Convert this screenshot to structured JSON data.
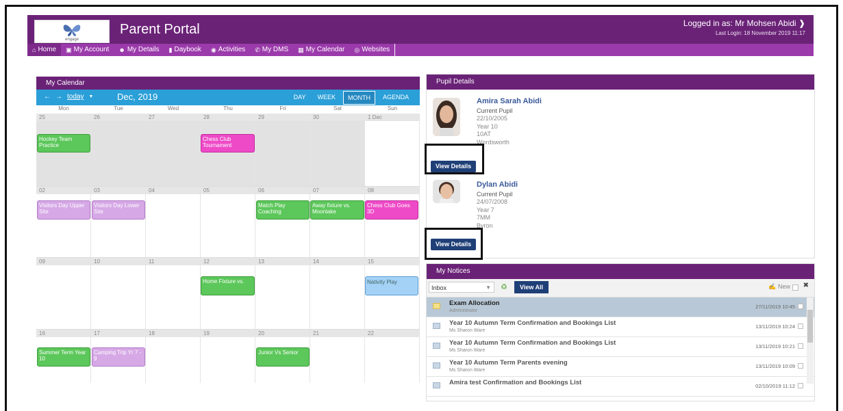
{
  "header": {
    "logo_text": "engage",
    "app_title": "Parent Portal",
    "logged_in": "Logged in as: Mr Mohsen Abidi",
    "last_login": "Last Login: 18 November 2019 11:17",
    "brand_color": "#6a2277"
  },
  "nav": {
    "items": [
      {
        "label": "Home",
        "icon": "home-icon"
      },
      {
        "label": "My Account",
        "icon": "id-card-icon"
      },
      {
        "label": "My Details",
        "icon": "user-icon"
      },
      {
        "label": "Daybook",
        "icon": "book-icon"
      },
      {
        "label": "Activities",
        "icon": "activity-icon"
      },
      {
        "label": "My DMS",
        "icon": "dms-icon"
      },
      {
        "label": "My Calendar",
        "icon": "calendar-icon"
      },
      {
        "label": "Websites",
        "icon": "globe-icon"
      }
    ]
  },
  "calendar": {
    "panel_title": "My Calendar",
    "today_label": "today",
    "month_title": "Dec, 2019",
    "views": [
      "DAY",
      "WEEK",
      "MONTH",
      "AGENDA"
    ],
    "active_view": "MONTH",
    "dow": [
      "Mon",
      "Tue",
      "Wed",
      "Thu",
      "Fri",
      "Sat",
      "Sun"
    ],
    "weeks": [
      [
        "25",
        "26",
        "27",
        "28",
        "29",
        "30",
        "1 Dec"
      ],
      [
        "02",
        "03",
        "04",
        "05",
        "06",
        "07",
        "08"
      ],
      [
        "09",
        "10",
        "11",
        "12",
        "13",
        "14",
        "15"
      ],
      [
        "16",
        "17",
        "18",
        "19",
        "20",
        "21",
        "22"
      ]
    ],
    "events": {
      "w1_hockey": "Hockey Team Practice",
      "w1_chess": "Chess Club Tournament",
      "w2_visitors_upper": "Visitors Day Upper Site",
      "w2_visitors_lower": "Visitors Day Lower Site",
      "w2_match": "Match Play Coaching",
      "w2_away": "Away fixture vs. Moonlake",
      "w2_chess3d": "Chess Club Goes 3D",
      "w3_home": "Home Fixture vs.",
      "w3_nativity": "Nativity Play",
      "w4_summer": "Summer Term Year 10",
      "w4_camping": "Camping Trip Yr 7 - 9",
      "w4_junior": "Junior Vs Senior"
    }
  },
  "pupils": {
    "panel_title": "Pupil Details",
    "list": [
      {
        "name": "Amira Sarah Abidi",
        "status": "Current Pupil",
        "dob": "22/10/2005",
        "year": "Year 10",
        "form": "10AT",
        "house": "Wordsworth",
        "button": "View Details"
      },
      {
        "name": "Dylan Abidi",
        "status": "Current Pupil",
        "dob": "24/07/2008",
        "year": "Year 7",
        "form": "7MM",
        "house": "Byron",
        "button": "View Details"
      }
    ]
  },
  "notices": {
    "panel_title": "My Notices",
    "folder": "Inbox",
    "view_all": "View All",
    "new_label": "New",
    "items": [
      {
        "subject": "Exam Allocation",
        "from": "Administrator",
        "date": "27/11/2019 10:45"
      },
      {
        "subject": "Year 10 Autumn Term Confirmation and Bookings List",
        "from": "Ms Sharon Ware",
        "date": "13/11/2019 10:24"
      },
      {
        "subject": "Year 10 Autumn Term Confirmation and Bookings List",
        "from": "Ms Sharon Ware",
        "date": "13/11/2019 10:21"
      },
      {
        "subject": "Year 10 Autumn Term Parents evening",
        "from": "Ms Sharon Ware",
        "date": "13/11/2019 10:09"
      },
      {
        "subject": "Amira test Confirmation and Bookings List",
        "from": "",
        "date": "02/10/2019 11:12"
      }
    ]
  }
}
